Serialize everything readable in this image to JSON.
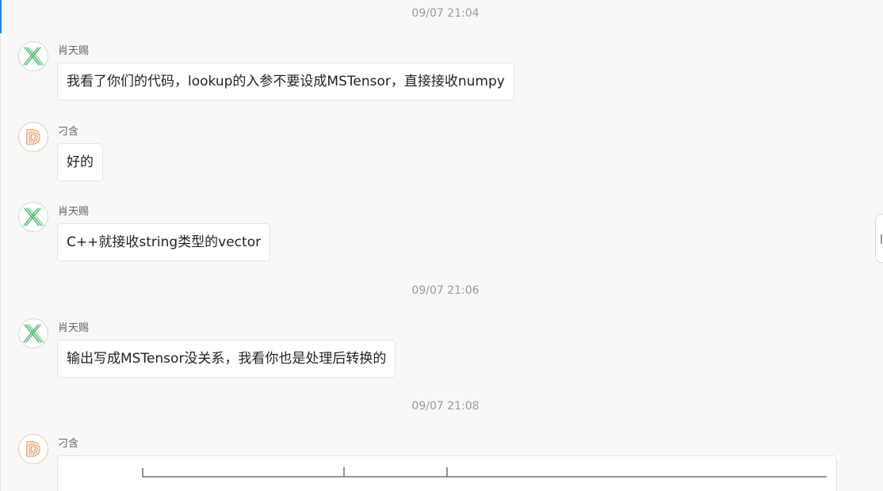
{
  "timestamps": [
    "09/07 21:04",
    "09/07 21:06",
    "09/07 21:08"
  ],
  "messages": [
    {
      "sender": "肖天赐",
      "avatar_icon": "x-avatar-icon",
      "text": "我看了你们的代码，lookup的入参不要设成MSTensor，直接接收numpy"
    },
    {
      "sender": "刁含",
      "avatar_icon": "d-avatar-icon",
      "text": "好的"
    },
    {
      "sender": "肖天赐",
      "avatar_icon": "x-avatar-icon",
      "text": "C++就接收string类型的vector"
    },
    {
      "sender": "肖天赐",
      "avatar_icon": "x-avatar-icon",
      "text": "输出写成MSTensor没关系，我看你也是处理后转换的"
    },
    {
      "sender": "刁含",
      "avatar_icon": "d-avatar-icon",
      "text": ""
    }
  ],
  "colors": {
    "accent": "#1e88e5",
    "x_avatar": "#5cb87a",
    "d_avatar": "#e8955c"
  }
}
